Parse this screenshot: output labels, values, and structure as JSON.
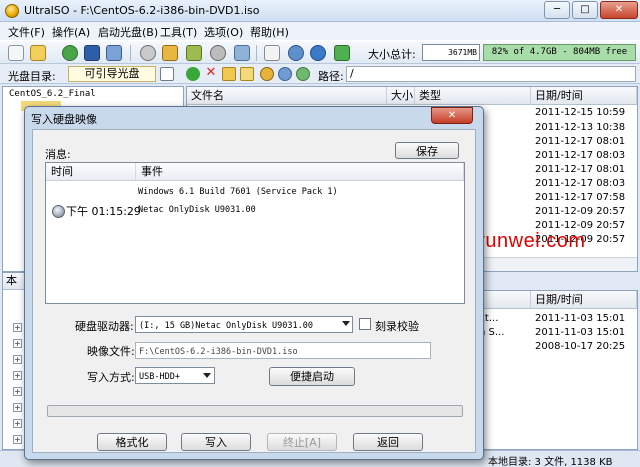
{
  "window": {
    "title": "UltraISO - F:\\CentOS-6.2-i386-bin-DVD1.iso",
    "controls": {
      "minimize": "─",
      "maximize": "□",
      "close": "✕"
    }
  },
  "menu": [
    "文件(F)",
    "操作(A)",
    "启动光盘(B)",
    "工具(T)",
    "选项(O)",
    "帮助(H)"
  ],
  "toolbar": {
    "total_label": "大小总计:",
    "total_value": "3671MB",
    "usage_text": "82% of 4.7GB - 804MB free",
    "usage_fraction": 0.82,
    "usage_color": "#a8dca8"
  },
  "discbar": {
    "disc_label": "光盘目录:",
    "disc_type": "可引导光盘",
    "path_label": "路径:",
    "path_value": "/"
  },
  "tree": {
    "root": "CentOS_6.2_Final",
    "local_header": "本"
  },
  "files": {
    "columns": {
      "name": "文件名",
      "size": "大小",
      "type": "类型",
      "date": "日期/时间"
    },
    "dates": [
      "2011-12-15 10:59",
      "2011-12-13 10:38",
      "2011-12-17 08:01",
      "2011-12-17 08:03",
      "2011-12-17 08:01",
      "2011-12-17 08:03",
      "2011-12-17 07:58",
      "2011-12-09 20:57",
      "2011-12-09 20:57",
      "2011-12-09 20:57"
    ]
  },
  "local_files": {
    "date_header": "日期/时间",
    "rows": [
      {
        "name_fragment": "xt...",
        "date": "2011-11-03 15:01"
      },
      {
        "name_fragment": "h S...",
        "date": "2011-11-03 15:01"
      },
      {
        "name_fragment": "",
        "date": "2008-10-17 20:25"
      }
    ]
  },
  "status": {
    "text": "本地目录: 3 文件, 1138 KB"
  },
  "watermark": "www.osyunwei.com",
  "dialog": {
    "title": "写入硬盘映像",
    "close": "✕",
    "messages_label": "消息:",
    "save_button": "保存",
    "log_columns": {
      "time": "时间",
      "event": "事件"
    },
    "log": [
      {
        "time": "",
        "event": "Windows 6.1 Build 7601 (Service Pack 1)"
      },
      {
        "time": "下午 01:15:29",
        "event": "Netac    OnlyDisk U9031.00"
      }
    ],
    "drive_label": "硬盘驱动器:",
    "drive_value": "(I:, 15 GB)Netac   OnlyDisk U9031.00",
    "verify_label": "刻录校验",
    "image_label": "映像文件:",
    "image_value": "F:\\CentOS-6.2-i386-bin-DVD1.iso",
    "method_label": "写入方式:",
    "method_value": "USB-HDD+",
    "boot_button": "便捷启动",
    "progress_fraction": 0.0,
    "buttons": {
      "format": "格式化",
      "write": "写入",
      "abort": "终止[A]",
      "back": "返回"
    }
  }
}
